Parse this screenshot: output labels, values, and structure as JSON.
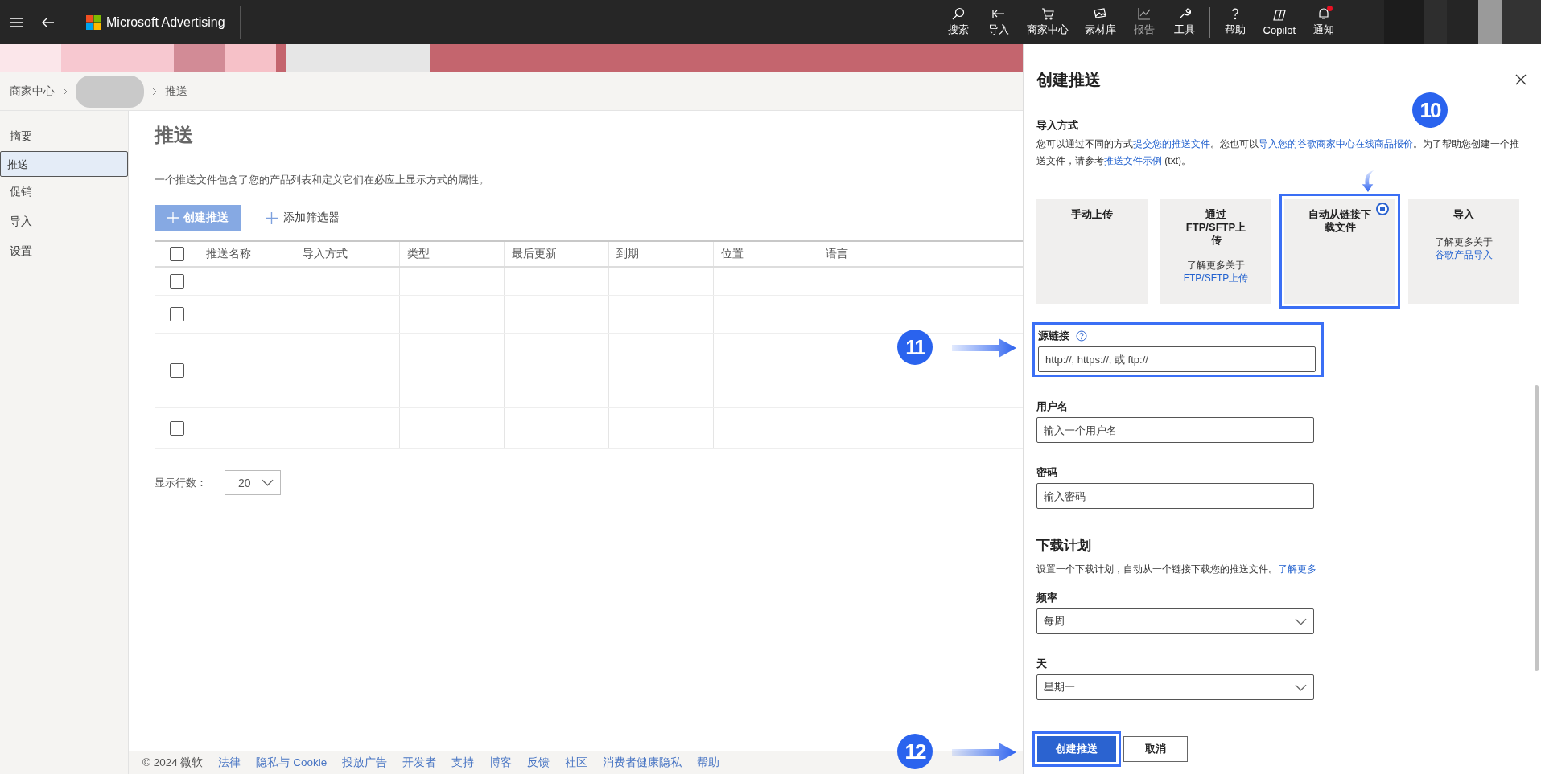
{
  "top_bar": {
    "brand": "Microsoft Advertising",
    "nav": [
      {
        "kind": "search",
        "label": "搜索",
        "disabled": false,
        "alert": false
      },
      {
        "kind": "import",
        "label": "导入",
        "disabled": false,
        "alert": false
      },
      {
        "kind": "cart",
        "label": "商家中心",
        "disabled": false,
        "alert": false
      },
      {
        "kind": "assets",
        "label": "素材库",
        "disabled": false,
        "alert": false
      },
      {
        "kind": "chart",
        "label": "报告",
        "disabled": true,
        "alert": false
      },
      {
        "kind": "wrench",
        "label": "工具",
        "disabled": false,
        "alert": false
      },
      {
        "kind": "help",
        "label": "帮助",
        "disabled": false,
        "alert": false
      },
      {
        "kind": "copilot",
        "label": "Copilot",
        "disabled": false,
        "alert": false
      },
      {
        "kind": "bell",
        "label": "通知",
        "disabled": false,
        "alert": true
      }
    ]
  },
  "breadcrumb": [
    "商家中心",
    "推送"
  ],
  "sidebar": {
    "items": [
      {
        "label": "摘要",
        "selected": false
      },
      {
        "label": "推送",
        "selected": true
      },
      {
        "label": "促销",
        "selected": false
      },
      {
        "label": "导入",
        "selected": false
      },
      {
        "label": "设置",
        "selected": false
      }
    ]
  },
  "page": {
    "title": "推送",
    "description": "一个推送文件包含了您的产品列表和定义它们在必应上显示方式的属性。",
    "create_button": {
      "label": "创建推送",
      "disabled": true
    },
    "filter_button": "添加筛选器",
    "table": {
      "columns": [
        "推送名称",
        "导入方式",
        "类型",
        "最后更新",
        "到期",
        "位置",
        "语言"
      ],
      "select_all_checked": false,
      "rows": [
        {
          "checked": false
        },
        {
          "checked": false
        },
        {
          "checked": false
        },
        {
          "checked": false
        }
      ]
    },
    "rows_per_page": {
      "label": "显示行数：",
      "value": "20"
    }
  },
  "footer": {
    "copyright": "© 2024 微软",
    "links": [
      "法律",
      "隐私与 Cookie",
      "投放广告",
      "开发者",
      "支持",
      "博客",
      "反馈",
      "社区",
      "消费者健康隐私",
      "帮助"
    ]
  },
  "panel": {
    "title": "创建推送",
    "import_method": {
      "label": "导入方式",
      "description": [
        {
          "text": "您可以通过不同的方式",
          "link": false
        },
        {
          "text": "提交您的推送文件",
          "link": true
        },
        {
          "text": "。您也可以",
          "link": false
        },
        {
          "text": "导入您的谷歌商家中心在线商品报价",
          "link": true
        },
        {
          "text": "。为了帮助您创建一个推送文件，请参考",
          "link": false
        },
        {
          "text": "推送文件示例",
          "link": true
        },
        {
          "text": " (txt)。",
          "link": false
        }
      ],
      "options": [
        {
          "title": "手动上传",
          "selected": false
        },
        {
          "title": "通过FTP/SFTP上传",
          "note": "了解更多关于",
          "link": "FTP/SFTP上传",
          "link_inline": false,
          "selected": false
        },
        {
          "title": "自动从链接下载文件",
          "selected": true
        },
        {
          "title": "导入",
          "note": "了解更多关于",
          "link": "谷歌产品导入",
          "link_inline": true,
          "selected": false
        }
      ]
    },
    "fields": [
      {
        "label": "源链接",
        "help": true,
        "placeholder": "http://, https://, 或 ftp://",
        "highlighted": true
      },
      {
        "label": "用户名",
        "help": false,
        "placeholder": "输入一个用户名",
        "highlighted": false
      },
      {
        "label": "密码",
        "help": false,
        "placeholder": "输入密码",
        "highlighted": false
      }
    ],
    "schedule": {
      "heading": "下载计划",
      "description": "设置一个下载计划，自动从一个链接下载您的推送文件。",
      "link": "了解更多",
      "selects": [
        {
          "label": "频率",
          "value": "每周"
        },
        {
          "label": "天",
          "value": "星期一"
        }
      ]
    },
    "buttons": [
      {
        "kind": "primary",
        "label": "创建推送",
        "highlighted": true
      },
      {
        "kind": "secondary",
        "label": "取消",
        "highlighted": false
      }
    ]
  },
  "annotations": [
    {
      "number": "10"
    },
    {
      "number": "11"
    },
    {
      "number": "12"
    }
  ]
}
